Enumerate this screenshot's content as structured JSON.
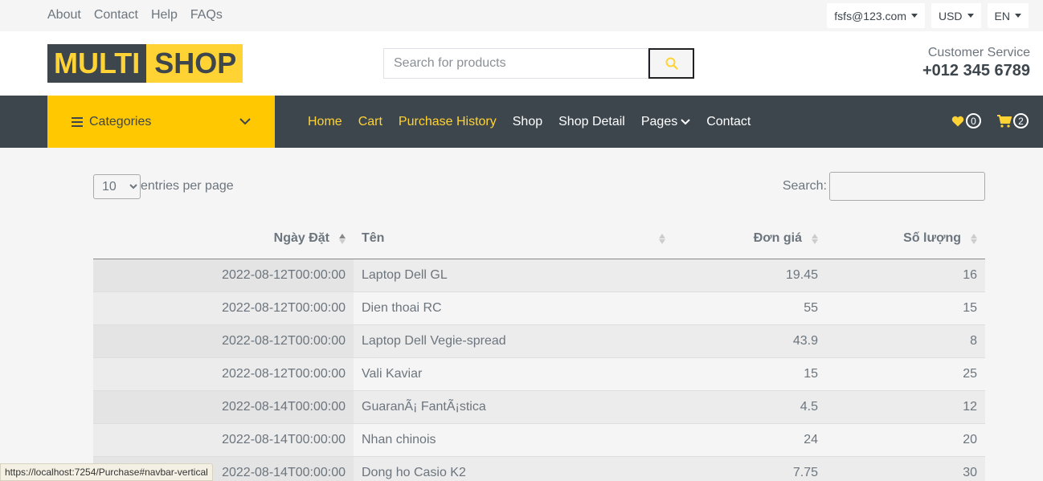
{
  "topbar": {
    "links": [
      "About",
      "Contact",
      "Help",
      "FAQs"
    ],
    "account": "fsfs@123.com",
    "currency": "USD",
    "language": "EN"
  },
  "header": {
    "logo_part1": "MULTI",
    "logo_part2": "SHOP",
    "search_placeholder": "Search for products",
    "cs_title": "Customer Service",
    "cs_phone": "+012 345 6789"
  },
  "nav": {
    "categories": "Categories",
    "items": [
      "Home",
      "Cart",
      "Purchase History",
      "Shop",
      "Shop Detail",
      "Pages",
      "Contact"
    ],
    "wishlist_count": "0",
    "cart_count": "2"
  },
  "table_controls": {
    "entries_value": "10",
    "entries_label": "entries per page",
    "search_label": "Search:"
  },
  "table": {
    "headers": [
      "Ngày Đặt",
      "Tên",
      "Đơn giá",
      "Số lượng"
    ],
    "rows": [
      [
        "2022-08-12T00:00:00",
        "Laptop Dell GL",
        "19.45",
        "16"
      ],
      [
        "2022-08-12T00:00:00",
        "Dien thoai RC",
        "55",
        "15"
      ],
      [
        "2022-08-12T00:00:00",
        "Laptop Dell Vegie-spread",
        "43.9",
        "8"
      ],
      [
        "2022-08-12T00:00:00",
        "Vali Kaviar",
        "15",
        "25"
      ],
      [
        "2022-08-14T00:00:00",
        "GuaranÃ¡ FantÃ¡stica",
        "4.5",
        "12"
      ],
      [
        "2022-08-14T00:00:00",
        "Nhan chinois",
        "24",
        "20"
      ],
      [
        "2022-08-14T00:00:00",
        "Dong ho Casio K2",
        "7.75",
        "30"
      ]
    ]
  },
  "status_url": "https://localhost:7254/Purchase#navbar-vertical",
  "colors": {
    "accent": "#ffd333",
    "dark": "#3d464d"
  }
}
